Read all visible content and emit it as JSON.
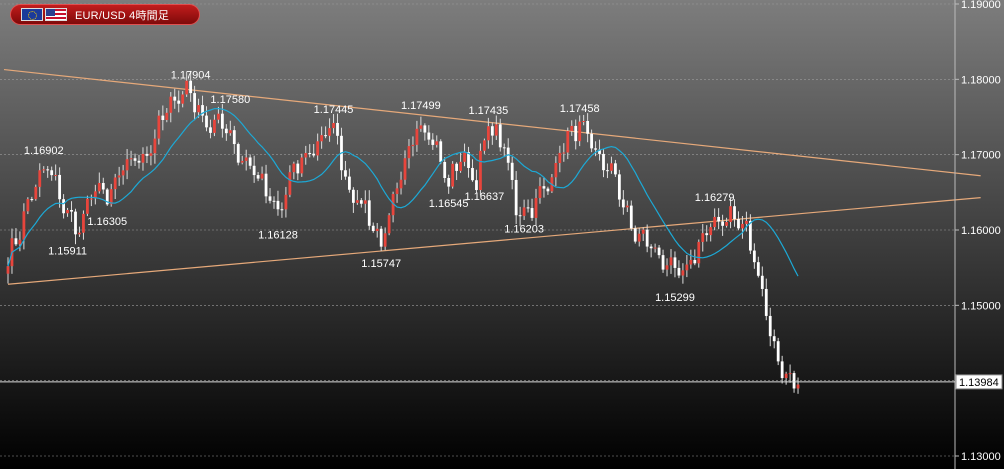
{
  "header": {
    "title": "EUR/USD 4時間足",
    "flags": [
      "eu-flag-icon",
      "us-flag-icon"
    ]
  },
  "colors": {
    "bg_top": "#7d7d7d",
    "bg_bottom": "#000000",
    "bull": "#e8453c",
    "bear": "#ffffff",
    "wick": "#dddddd",
    "ma": "#1ca9d6",
    "trend": "#e6a97a",
    "grid": "#9a9a9a",
    "axis_text": "#ffffff"
  },
  "chart_data": {
    "type": "candlestick",
    "title": "EUR/USD 4時間足",
    "ylim": [
      1.13,
      1.19
    ],
    "y_ticks": [
      1.19,
      1.18,
      1.17,
      1.16,
      1.15,
      1.14,
      1.13
    ],
    "y_tick_labels": [
      "1.19000",
      "1.18000",
      "1.17000",
      "1.16000",
      "1.15000",
      "1.14000",
      "1.13000"
    ],
    "current_price": 1.13984,
    "current_price_label": "1.13984",
    "grid": true,
    "bar_count": 200,
    "keypoints": [
      {
        "i": 0,
        "p": 1.156
      },
      {
        "i": 3,
        "p": 1.16
      },
      {
        "i": 6,
        "p": 1.165
      },
      {
        "i": 10,
        "p": 1.1685
      },
      {
        "i": 15,
        "p": 1.162
      },
      {
        "i": 18,
        "p": 1.16
      },
      {
        "i": 22,
        "p": 1.166
      },
      {
        "i": 25,
        "p": 1.164
      },
      {
        "i": 30,
        "p": 1.169
      },
      {
        "i": 35,
        "p": 1.17
      },
      {
        "i": 40,
        "p": 1.176
      },
      {
        "i": 45,
        "p": 1.179
      },
      {
        "i": 50,
        "p": 1.174
      },
      {
        "i": 55,
        "p": 1.174
      },
      {
        "i": 58,
        "p": 1.17
      },
      {
        "i": 62,
        "p": 1.168
      },
      {
        "i": 68,
        "p": 1.162
      },
      {
        "i": 72,
        "p": 1.168
      },
      {
        "i": 78,
        "p": 1.1715
      },
      {
        "i": 82,
        "p": 1.174
      },
      {
        "i": 86,
        "p": 1.165
      },
      {
        "i": 90,
        "p": 1.163
      },
      {
        "i": 94,
        "p": 1.158
      },
      {
        "i": 98,
        "p": 1.165
      },
      {
        "i": 103,
        "p": 1.1745
      },
      {
        "i": 107,
        "p": 1.172
      },
      {
        "i": 111,
        "p": 1.166
      },
      {
        "i": 114,
        "p": 1.17
      },
      {
        "i": 118,
        "p": 1.1665
      },
      {
        "i": 121,
        "p": 1.174
      },
      {
        "i": 125,
        "p": 1.171
      },
      {
        "i": 128,
        "p": 1.163
      },
      {
        "i": 131,
        "p": 1.1625
      },
      {
        "i": 136,
        "p": 1.166
      },
      {
        "i": 140,
        "p": 1.1715
      },
      {
        "i": 144,
        "p": 1.174
      },
      {
        "i": 148,
        "p": 1.17
      },
      {
        "i": 153,
        "p": 1.167
      },
      {
        "i": 157,
        "p": 1.16
      },
      {
        "i": 162,
        "p": 1.158
      },
      {
        "i": 166,
        "p": 1.155
      },
      {
        "i": 170,
        "p": 1.154
      },
      {
        "i": 174,
        "p": 1.158
      },
      {
        "i": 178,
        "p": 1.161
      },
      {
        "i": 182,
        "p": 1.162
      },
      {
        "i": 186,
        "p": 1.16
      },
      {
        "i": 190,
        "p": 1.152
      },
      {
        "i": 193,
        "p": 1.144
      },
      {
        "i": 196,
        "p": 1.1405
      },
      {
        "i": 199,
        "p": 1.1398
      }
    ],
    "annotations": [
      {
        "label": "1.17904",
        "i": 46,
        "value": 1.17904,
        "pos": "above"
      },
      {
        "label": "1.17580",
        "i": 56,
        "value": 1.1758,
        "pos": "above"
      },
      {
        "label": "1.17445",
        "i": 82,
        "value": 1.17445,
        "pos": "above"
      },
      {
        "label": "1.17499",
        "i": 104,
        "value": 1.17499,
        "pos": "above"
      },
      {
        "label": "1.17435",
        "i": 121,
        "value": 1.17435,
        "pos": "above"
      },
      {
        "label": "1.17458",
        "i": 144,
        "value": 1.17458,
        "pos": "above"
      },
      {
        "label": "1.16902",
        "i": 9,
        "value": 1.16902,
        "pos": "above"
      },
      {
        "label": "1.16279",
        "i": 178,
        "value": 1.16279,
        "pos": "above"
      },
      {
        "label": "1.16305",
        "i": 25,
        "value": 1.16305,
        "pos": "below"
      },
      {
        "label": "1.15911",
        "i": 15,
        "value": 1.15911,
        "pos": "below"
      },
      {
        "label": "1.16128",
        "i": 68,
        "value": 1.16128,
        "pos": "below"
      },
      {
        "label": "1.15747",
        "i": 94,
        "value": 1.15747,
        "pos": "below"
      },
      {
        "label": "1.16545",
        "i": 111,
        "value": 1.16545,
        "pos": "below"
      },
      {
        "label": "1.16637",
        "i": 120,
        "value": 1.16637,
        "pos": "below"
      },
      {
        "label": "1.16203",
        "i": 130,
        "value": 1.16203,
        "pos": "below"
      },
      {
        "label": "1.15299",
        "i": 168,
        "value": 1.15299,
        "pos": "below"
      }
    ],
    "trendlines": [
      {
        "name": "upper-trendline",
        "from": {
          "i": -1,
          "p": 1.1813
        },
        "to": {
          "i": 245,
          "p": 1.1672
        }
      },
      {
        "name": "lower-trendline",
        "from": {
          "i": 0,
          "p": 1.1528
        },
        "to": {
          "i": 245,
          "p": 1.1643
        }
      }
    ],
    "moving_average": {
      "period": 15,
      "end_index": 199
    }
  }
}
